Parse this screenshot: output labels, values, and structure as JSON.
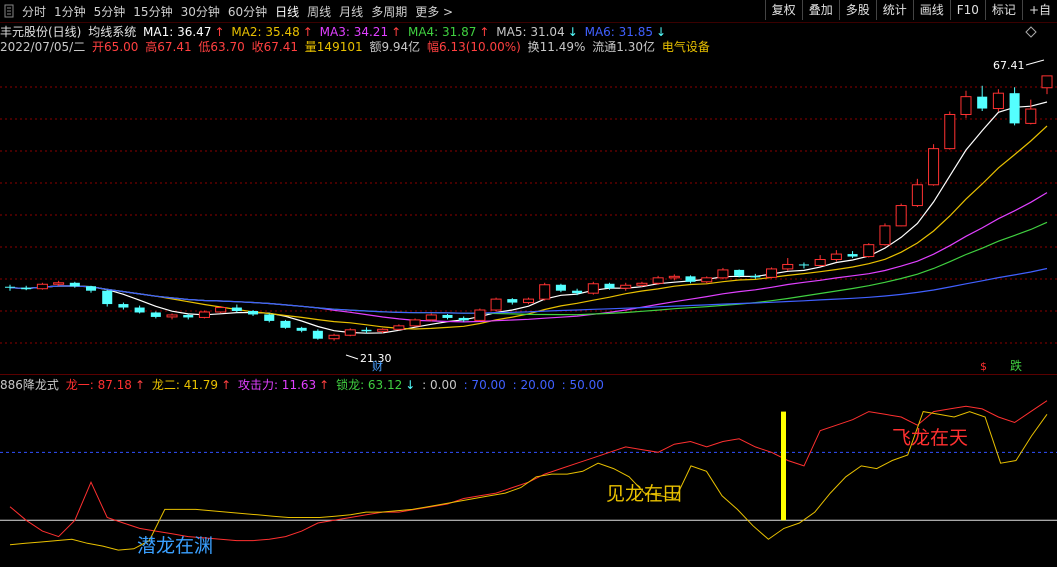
{
  "toolbar": {
    "periods": [
      "分时",
      "1分钟",
      "5分钟",
      "15分钟",
      "30分钟",
      "60分钟",
      "日线",
      "周线",
      "月线",
      "多周期",
      "更多 >"
    ],
    "active_index": 6,
    "buttons": [
      "复权",
      "叠加",
      "多股",
      "统计",
      "画线",
      "F10",
      "标记",
      "+自"
    ]
  },
  "main": {
    "title": "丰元股份(日线)",
    "indicator": "均线系统",
    "ma": [
      {
        "label": "MA1: 36.47",
        "arrow": "↑",
        "color": "#ffffff"
      },
      {
        "label": "MA2: 35.48",
        "arrow": "↑",
        "color": "#e8c000"
      },
      {
        "label": "MA3: 34.21",
        "arrow": "↑",
        "color": "#e040ff"
      },
      {
        "label": "MA4: 31.87",
        "arrow": "↑",
        "color": "#40d040"
      },
      {
        "label": "MA5: 31.04",
        "arrow": "↓",
        "color": "#c8c8c8"
      },
      {
        "label": "MA6: 31.85",
        "arrow": "↓",
        "color": "#4060ff"
      }
    ],
    "info": {
      "date": "2022/07/05/二",
      "open": "开65.00",
      "high": "高67.41",
      "low": "低63.70",
      "close": "收67.41",
      "volume": "量149101",
      "amount": "额9.94亿",
      "change": "幅6.13(10.00%)",
      "turnover": "换11.49%",
      "float": "流通1.30亿",
      "sector": "电气设备"
    },
    "high_label": "67.41",
    "low_label": "21.30",
    "marker_cai": "财",
    "marker_s": "$",
    "marker_die": "跌"
  },
  "sub": {
    "name": "886降龙式",
    "items": [
      {
        "label": "龙一: 87.18",
        "arrow": "↑",
        "color": "#ff3030"
      },
      {
        "label": "龙二: 41.79",
        "arrow": "↑",
        "color": "#e8c000"
      },
      {
        "label": "攻击力: 11.63",
        "arrow": "↑",
        "color": "#e040ff"
      },
      {
        "label": "锁龙: 63.12",
        "arrow": "↓",
        "color": "#40d040"
      },
      {
        "label": ": 0.00",
        "arrow": "",
        "color": "#c8c8c8"
      },
      {
        "label": ": 70.00",
        "arrow": "",
        "color": "#4060ff"
      },
      {
        "label": ": 20.00",
        "arrow": "",
        "color": "#4060ff"
      },
      {
        "label": ": 50.00",
        "arrow": "",
        "color": "#4060ff"
      }
    ],
    "text_qianlong": "潜龙在渊",
    "text_jianlong": "见龙在田",
    "text_feilong": "飞龙在天"
  },
  "colors": {
    "up": "#ff3232",
    "down": "#54ffff",
    "ma1": "#ffffff",
    "ma2": "#e8c000",
    "ma3": "#e040ff",
    "ma4": "#40d040",
    "ma6": "#4060ff",
    "long1": "#ff3030",
    "long2": "#e8c000",
    "grid": "#8b0000"
  },
  "chart_data": [
    {
      "type": "candlestick",
      "series": [
        {
          "name": "K",
          "values": [
            [
              24.8,
              25.2,
              24.0,
              24.6
            ],
            [
              24.6,
              25.0,
              24.1,
              24.3
            ],
            [
              24.4,
              25.6,
              24.2,
              25.3
            ],
            [
              25.3,
              26.0,
              25.0,
              25.6
            ],
            [
              25.6,
              25.8,
              24.6,
              24.9
            ],
            [
              24.9,
              25.0,
              23.6,
              24.0
            ],
            [
              24.0,
              24.2,
              20.8,
              21.3
            ],
            [
              21.3,
              21.6,
              20.2,
              20.6
            ],
            [
              20.6,
              21.0,
              19.4,
              19.6
            ],
            [
              19.6,
              19.8,
              18.4,
              18.7
            ],
            [
              18.7,
              19.4,
              18.2,
              19.1
            ],
            [
              19.1,
              19.3,
              18.2,
              18.6
            ],
            [
              18.6,
              20.0,
              18.4,
              19.7
            ],
            [
              19.7,
              20.9,
              19.5,
              20.6
            ],
            [
              20.6,
              21.2,
              19.6,
              19.9
            ],
            [
              19.9,
              20.1,
              18.9,
              19.2
            ],
            [
              19.2,
              19.4,
              17.6,
              17.9
            ],
            [
              17.9,
              18.1,
              16.3,
              16.5
            ],
            [
              16.5,
              16.7,
              15.6,
              15.9
            ],
            [
              15.9,
              16.2,
              14.1,
              14.3
            ],
            [
              14.3,
              15.3,
              13.9,
              15.0
            ],
            [
              15.0,
              16.4,
              14.8,
              16.1
            ],
            [
              16.1,
              16.6,
              15.4,
              15.8
            ],
            [
              15.8,
              16.4,
              15.4,
              16.2
            ],
            [
              16.2,
              17.2,
              16.0,
              16.9
            ],
            [
              16.9,
              18.4,
              16.7,
              18.1
            ],
            [
              18.1,
              19.4,
              17.8,
              19.1
            ],
            [
              19.1,
              19.3,
              18.2,
              18.5
            ],
            [
              18.5,
              18.8,
              17.7,
              18.0
            ],
            [
              18.0,
              20.4,
              17.9,
              20.1
            ],
            [
              20.1,
              22.6,
              19.9,
              22.3
            ],
            [
              22.3,
              22.5,
              21.2,
              21.6
            ],
            [
              21.6,
              22.6,
              21.3,
              22.3
            ],
            [
              22.3,
              25.6,
              22.0,
              25.2
            ],
            [
              25.2,
              25.4,
              23.7,
              24.0
            ],
            [
              24.0,
              24.4,
              23.1,
              23.5
            ],
            [
              23.5,
              25.8,
              23.2,
              25.4
            ],
            [
              25.4,
              25.6,
              24.2,
              24.5
            ],
            [
              24.5,
              25.6,
              24.0,
              25.1
            ],
            [
              25.1,
              25.8,
              24.8,
              25.5
            ],
            [
              25.5,
              27.0,
              25.2,
              26.6
            ],
            [
              26.6,
              27.3,
              26.1,
              26.9
            ],
            [
              26.9,
              27.1,
              25.5,
              25.8
            ],
            [
              25.8,
              26.9,
              25.5,
              26.6
            ],
            [
              26.6,
              28.6,
              26.3,
              28.2
            ],
            [
              28.2,
              28.3,
              26.7,
              27.0
            ],
            [
              27.0,
              27.4,
              26.4,
              26.7
            ],
            [
              26.7,
              28.7,
              26.5,
              28.4
            ],
            [
              28.4,
              30.6,
              28.0,
              29.3
            ],
            [
              29.3,
              29.7,
              28.5,
              29.1
            ],
            [
              29.1,
              31.2,
              28.9,
              30.3
            ],
            [
              30.3,
              32.2,
              29.9,
              31.4
            ],
            [
              31.4,
              32.0,
              30.6,
              30.9
            ],
            [
              30.9,
              33.6,
              30.7,
              33.3
            ],
            [
              33.3,
              37.6,
              33.1,
              37.1
            ],
            [
              37.1,
              41.6,
              37.0,
              41.2
            ],
            [
              41.2,
              46.6,
              40.9,
              45.4
            ],
            [
              45.4,
              53.6,
              45.2,
              52.7
            ],
            [
              52.7,
              60.2,
              52.5,
              59.6
            ],
            [
              59.6,
              64.4,
              58.9,
              63.2
            ],
            [
              63.2,
              65.4,
              60.3,
              60.8
            ],
            [
              60.8,
              64.7,
              60.2,
              63.9
            ],
            [
              63.9,
              65.1,
              57.4,
              57.8
            ],
            [
              57.8,
              62.6,
              57.6,
              60.7
            ],
            [
              65.0,
              67.4,
              63.7,
              67.4
            ]
          ]
        }
      ]
    },
    {
      "type": "line",
      "series": [
        {
          "name": "龙一",
          "values": [
            30,
            20,
            12,
            8,
            20,
            48,
            22,
            18,
            14,
            12,
            10,
            8,
            7,
            6,
            5,
            5,
            6,
            8,
            12,
            18,
            20,
            22,
            24,
            26,
            26,
            28,
            30,
            32,
            36,
            38,
            40,
            44,
            48,
            54,
            58,
            62,
            66,
            70,
            74,
            72,
            70,
            76,
            78,
            74,
            78,
            80,
            74,
            70,
            64,
            60,
            86,
            90,
            94,
            100,
            98,
            96,
            90,
            100,
            102,
            104,
            102,
            96,
            92,
            100,
            108
          ]
        },
        {
          "name": "龙二",
          "values": [
            2,
            3,
            4,
            5,
            6,
            3,
            1,
            -2,
            -1,
            5,
            28,
            28,
            28,
            27,
            26,
            25,
            24,
            23,
            22,
            22,
            22,
            23,
            24,
            26,
            26,
            27,
            28,
            30,
            32,
            34,
            36,
            38,
            40,
            44,
            52,
            54,
            54,
            56,
            62,
            58,
            52,
            40,
            38,
            36,
            60,
            56,
            38,
            28,
            16,
            6,
            14,
            18,
            26,
            40,
            52,
            60,
            58,
            64,
            68,
            100,
            98,
            96,
            100,
            96,
            62,
            64,
            82,
            98
          ]
        }
      ]
    }
  ]
}
